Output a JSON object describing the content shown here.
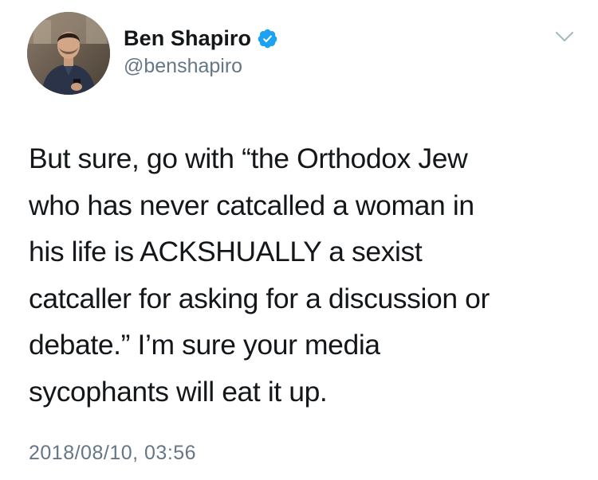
{
  "author": {
    "display_name": "Ben Shapiro",
    "handle": "@benshapiro",
    "verified": true,
    "avatar": "profile-photo"
  },
  "tweet": {
    "text": "But sure, go with “the Orthodox Jew\nwho has never catcalled a woman in\nhis life is ACKSHUALLY a sexist\ncatcaller for asking for a discussion or\ndebate.” I’m sure your media\nsycophants will eat it up.",
    "timestamp": "2018/08/10, 03:56"
  },
  "icons": {
    "verified": "verified-badge-icon",
    "menu": "chevron-down-icon"
  },
  "colors": {
    "text_primary": "#14171a",
    "text_secondary": "#657786",
    "verified_blue": "#1da1f2",
    "background": "#ffffff"
  }
}
